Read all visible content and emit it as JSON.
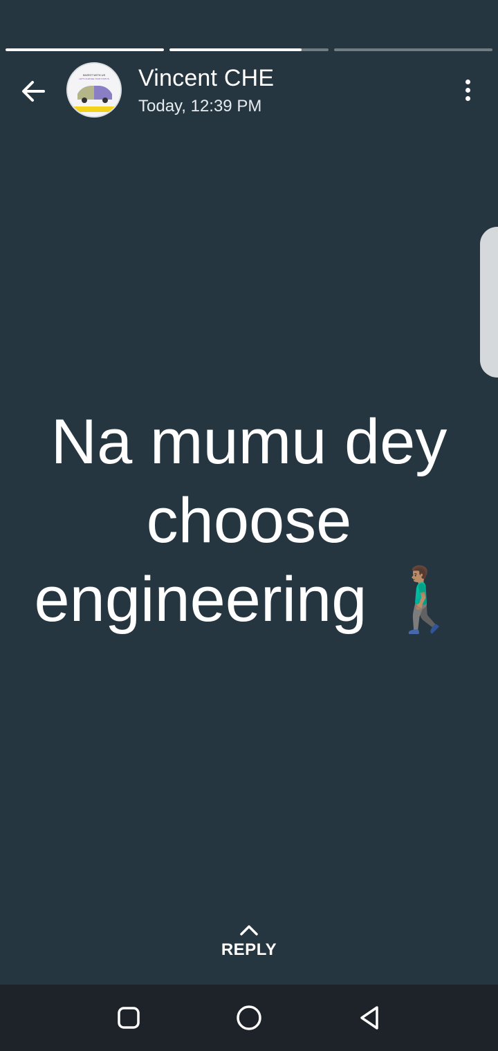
{
  "story": {
    "segments": [
      {
        "progress": 1.0
      },
      {
        "progress": 0.83
      },
      {
        "progress": 0.0
      }
    ]
  },
  "header": {
    "name": "Vincent CHE",
    "time": "Today, 12:39 PM",
    "back_icon": "arrow-left-icon",
    "menu_icon": "more-vert-icon",
    "avatar": {
      "line1": "INVEST WITH US",
      "line2": "LET'S CHANGE YOUR STATUS"
    }
  },
  "status": {
    "text": "Na mumu dey choose engineering 🚶🏽‍♂️",
    "background": "#263641"
  },
  "reply": {
    "label": "REPLY",
    "icon": "chevron-up-icon"
  },
  "navbar": {
    "recents_icon": "square-icon",
    "home_icon": "circle-icon",
    "back_icon": "triangle-back-icon"
  }
}
